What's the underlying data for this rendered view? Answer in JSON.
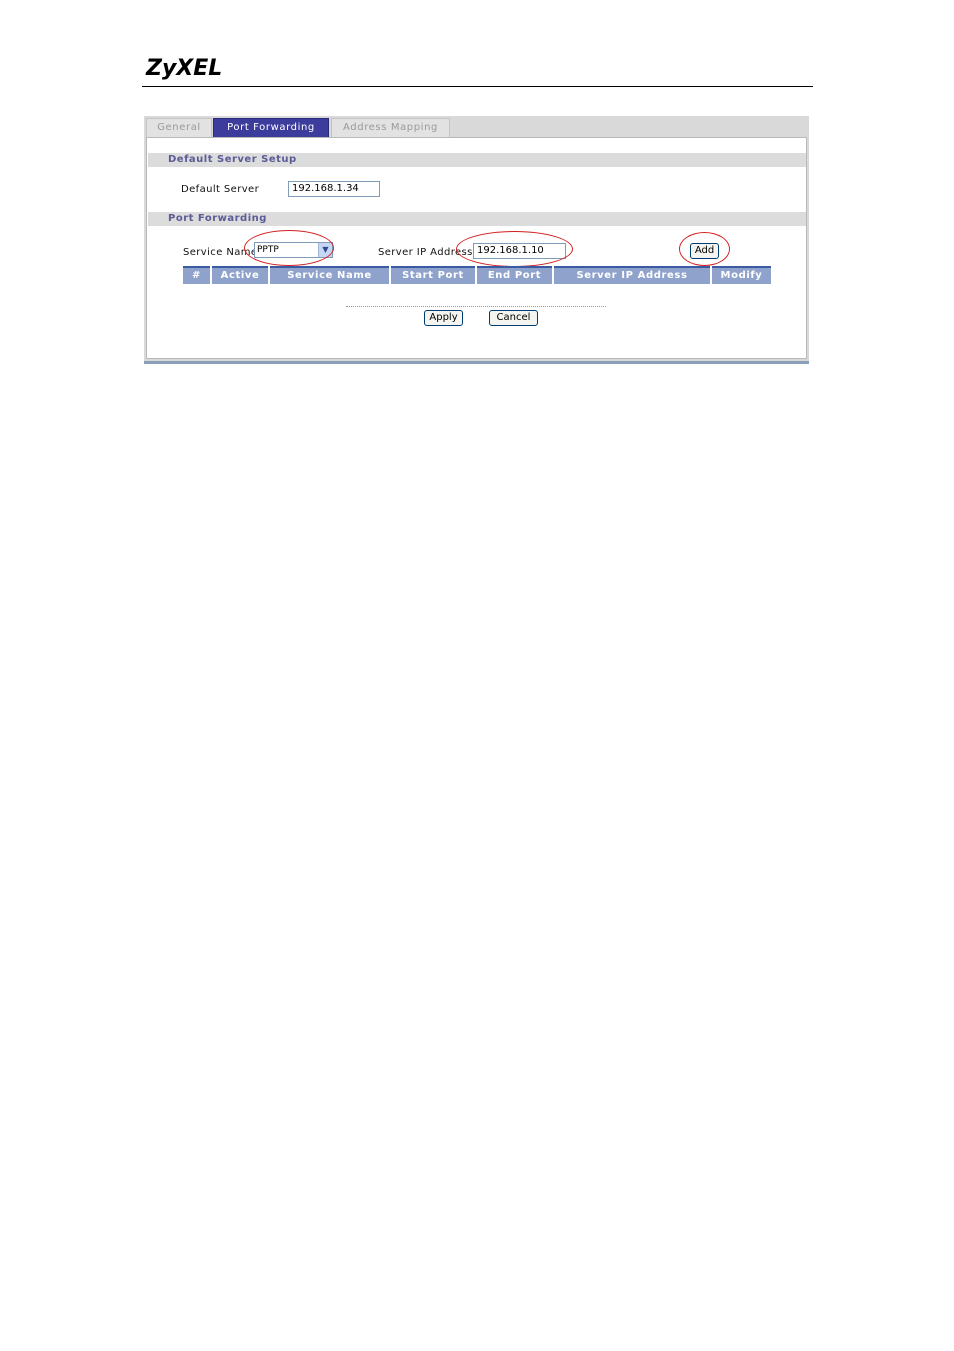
{
  "brand": {
    "logo_text": "ZyXEL"
  },
  "tabs": [
    {
      "label": "General",
      "active": false
    },
    {
      "label": "Port Forwarding",
      "active": true
    },
    {
      "label": "Address Mapping",
      "active": false
    }
  ],
  "default_server_section": {
    "title": "Default Server Setup",
    "field_label": "Default Server",
    "field_value": "192.168.1.34"
  },
  "port_forwarding_section": {
    "title": "Port Forwarding",
    "service_name_label": "Service Name",
    "service_name_selected": "PPTP",
    "server_ip_label": "Server IP Address",
    "server_ip_value": "192.168.1.10",
    "add_label": "Add"
  },
  "table": {
    "columns": [
      "#",
      "Active",
      "Service Name",
      "Start Port",
      "End Port",
      "Server IP Address",
      "Modify"
    ]
  },
  "actions": {
    "apply_label": "Apply",
    "cancel_label": "Cancel"
  },
  "colors": {
    "tab_active": "#3c3c9c",
    "section_title": "#5b5b96",
    "table_header": "#8ea2cc",
    "highlight_ellipse": "#d22020"
  }
}
